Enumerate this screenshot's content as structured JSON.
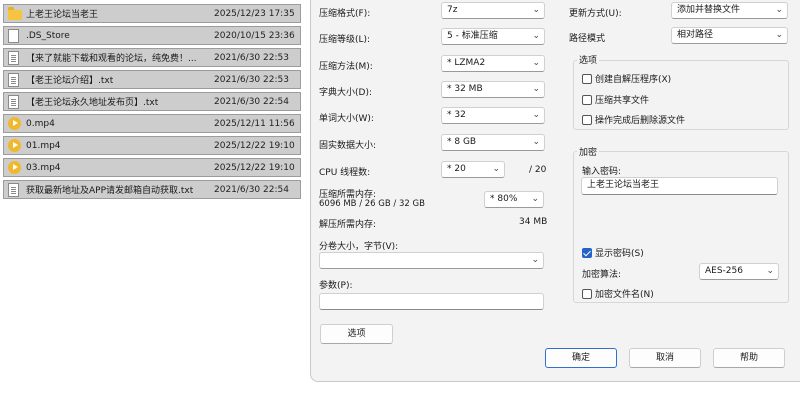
{
  "files": [
    {
      "icon": "folder-icon",
      "name": "上老王论坛当老王",
      "date": "2025/12/23 17:35"
    },
    {
      "icon": "document-icon",
      "name": ".DS_Store",
      "date": "2020/10/15 23:36"
    },
    {
      "icon": "text-file-icon",
      "name": "【来了就能下载和观看的论坛，纯免费！...",
      "date": "2021/6/30 22:53"
    },
    {
      "icon": "text-file-icon",
      "name": "【老王论坛介绍】.txt",
      "date": "2021/6/30 22:53"
    },
    {
      "icon": "text-file-icon",
      "name": "【老王论坛永久地址发布页】.txt",
      "date": "2021/6/30 22:54"
    },
    {
      "icon": "video-file-icon",
      "name": "0.mp4",
      "date": "2025/12/11 11:56"
    },
    {
      "icon": "video-file-icon",
      "name": "01.mp4",
      "date": "2025/12/22 19:10"
    },
    {
      "icon": "video-file-icon",
      "name": "03.mp4",
      "date": "2025/12/22 19:10"
    },
    {
      "icon": "text-file-icon",
      "name": "获取最新地址及APP请发邮箱自动获取.txt",
      "date": "2021/6/30 22:54"
    }
  ],
  "dialog": {
    "format": {
      "label": "压缩格式(F):",
      "value": "7z"
    },
    "level": {
      "label": "压缩等级(L):",
      "value": "5 - 标准压缩"
    },
    "method": {
      "label": "压缩方法(M):",
      "value": "* LZMA2"
    },
    "dict": {
      "label": "字典大小(D):",
      "value": "* 32 MB"
    },
    "word": {
      "label": "单词大小(W):",
      "value": "* 32"
    },
    "solid": {
      "label": "固实数据大小:",
      "value": "* 8 GB"
    },
    "threads": {
      "label": "CPU 线程数:",
      "value": "* 20",
      "max": "/ 20"
    },
    "mem_compress": {
      "label": "压缩所需内存:",
      "detail": "6096 MB / 26 GB / 32 GB",
      "value": "* 80%"
    },
    "mem_decompress": {
      "label": "解压所需内存:",
      "value": "34 MB"
    },
    "split": {
      "label": "分卷大小，字节(V):",
      "value": ""
    },
    "params": {
      "label": "参数(P):",
      "value": ""
    },
    "options_button": "选项",
    "update_mode": {
      "label": "更新方式(U):",
      "value": "添加并替换文件"
    },
    "path_mode": {
      "label": "路径模式",
      "value": "相对路径"
    },
    "options_group": {
      "title": "选项",
      "sfx": "创建自解压程序(X)",
      "shared": "压缩共享文件",
      "delete": "操作完成后删除源文件"
    },
    "encryption": {
      "title": "加密",
      "password_label": "输入密码:",
      "password_value": "上老王论坛当老王",
      "show_password": "显示密码(S)",
      "algo_label": "加密算法:",
      "algo_value": "AES-256",
      "encrypt_names": "加密文件名(N)"
    },
    "buttons": {
      "ok": "确定",
      "cancel": "取消",
      "help": "帮助"
    }
  }
}
